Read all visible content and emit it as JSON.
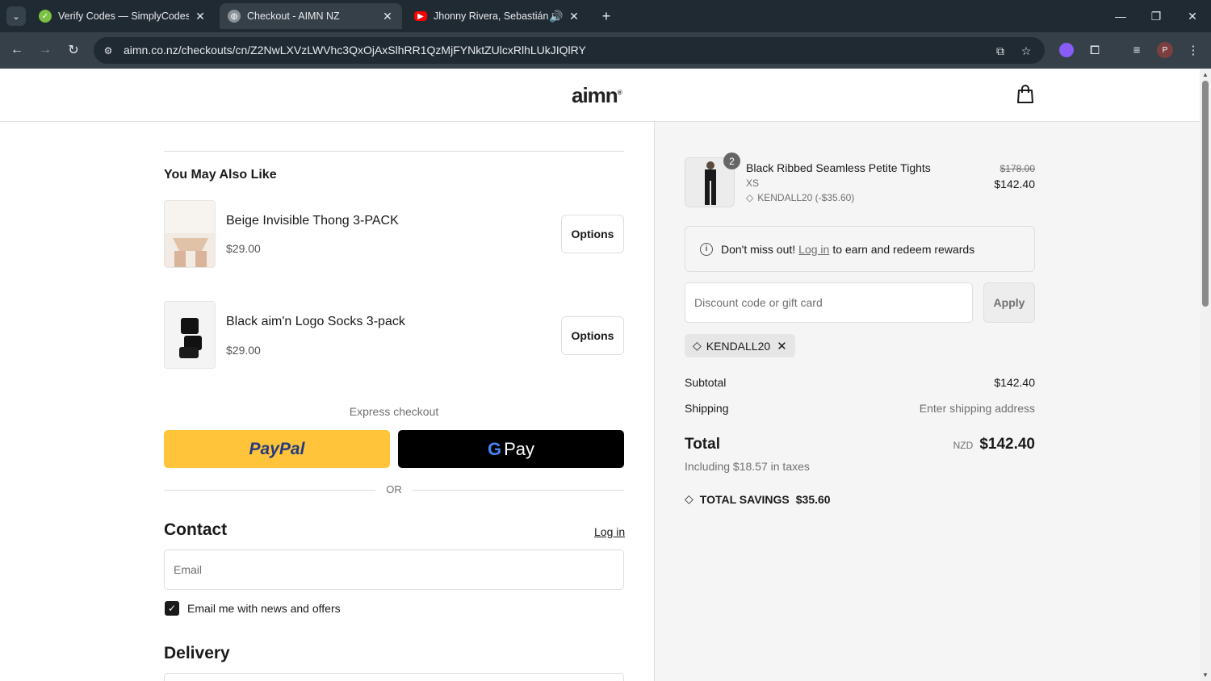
{
  "browser": {
    "tabs": [
      {
        "title": "Verify Codes — SimplyCodes",
        "active": false
      },
      {
        "title": "Checkout - AIMN NZ",
        "active": true
      },
      {
        "title": "Jhonny Rivera, Sebastián Ay",
        "active": false
      }
    ],
    "url": "aimn.co.nz/checkouts/cn/Z2NwLXVzLWVhc3QxOjAxSlhRR1QzMjFYNktZUlcxRlhLUkJIQlRY",
    "profile_initial": "P"
  },
  "header": {
    "logo": "aimn",
    "logo_mark": "®"
  },
  "upsell": {
    "title": "You May Also Like",
    "items": [
      {
        "name": "Beige Invisible Thong 3-PACK",
        "price": "$29.00",
        "button": "Options"
      },
      {
        "name": "Black aim'n Logo Socks 3-pack",
        "price": "$29.00",
        "button": "Options"
      }
    ]
  },
  "express": {
    "label": "Express checkout",
    "paypal": "PayPal",
    "gpay": "Pay",
    "or": "OR"
  },
  "contact": {
    "title": "Contact",
    "login": "Log in",
    "email_placeholder": "Email",
    "newsletter_label": "Email me with news and offers",
    "newsletter_checked": true
  },
  "delivery": {
    "title": "Delivery"
  },
  "summary": {
    "product": {
      "name": "Black Ribbed Seamless Petite Tights",
      "variant": "XS",
      "discount": "KENDALL20 (-$35.60)",
      "quantity": "2",
      "original_price": "$178.00",
      "price": "$142.40"
    },
    "notice": {
      "prefix": "Don't miss out!",
      "link": "Log in",
      "suffix": "to earn and redeem rewards"
    },
    "discount": {
      "placeholder": "Discount code or gift card",
      "apply": "Apply",
      "applied_code": "KENDALL20"
    },
    "subtotal_label": "Subtotal",
    "subtotal": "$142.40",
    "shipping_label": "Shipping",
    "shipping": "Enter shipping address",
    "total_label": "Total",
    "currency": "NZD",
    "total": "$142.40",
    "taxes": "Including $18.57 in taxes",
    "savings_label": "TOTAL SAVINGS",
    "savings": "$35.60"
  },
  "colors": {
    "paypal": "#ffc439",
    "gpay": "#000000",
    "browser_frame": "#1f2a33",
    "summary_bg": "#f5f5f5"
  }
}
